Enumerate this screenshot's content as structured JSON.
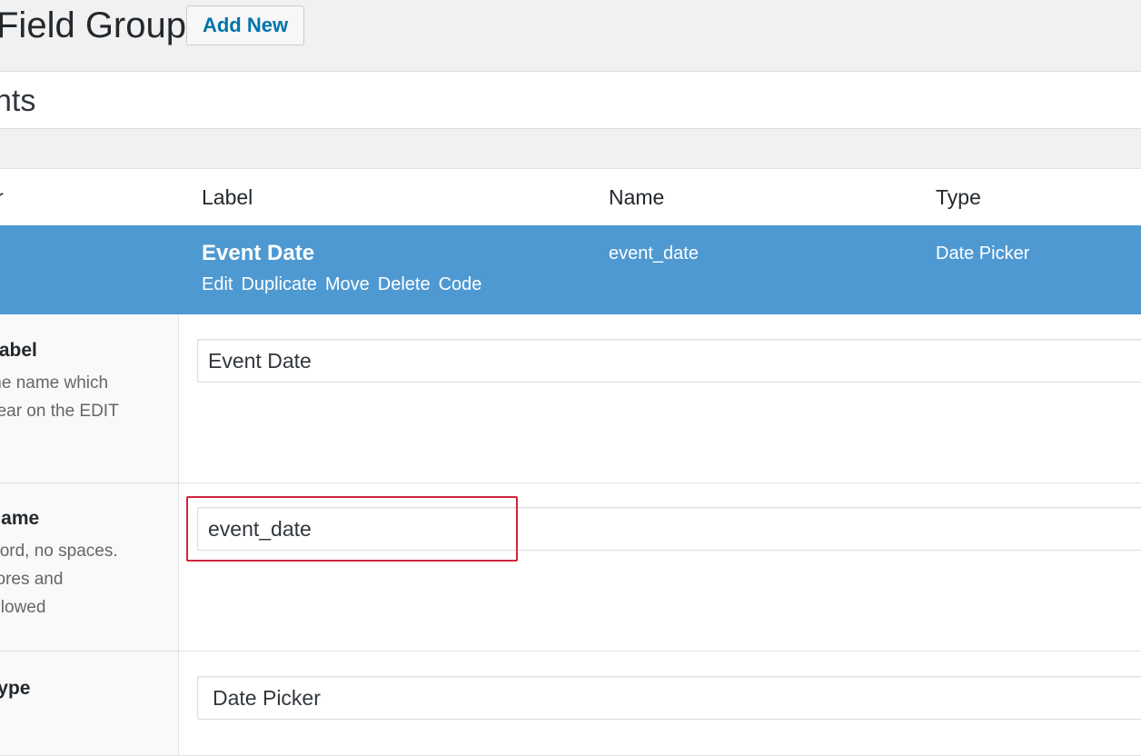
{
  "header": {
    "title": "Field Group",
    "add_new_label": "Add New"
  },
  "title_input": {
    "value": "nts"
  },
  "columns": {
    "order": "r",
    "label": "Label",
    "name": "Name",
    "type": "Type"
  },
  "field": {
    "label": "Event Date",
    "name": "event_date",
    "type": "Date Picker",
    "actions": [
      "Edit",
      "Duplicate",
      "Move",
      "Delete",
      "Code"
    ]
  },
  "settings": {
    "label": {
      "title": "Label",
      "description": [
        "the name which",
        "pear on the EDIT"
      ],
      "value": "Event Date"
    },
    "name": {
      "title": "Name",
      "description": [
        "word, no spaces.",
        "cores and",
        "allowed"
      ],
      "value": "event_date"
    },
    "type": {
      "title": "Type",
      "value": "Date Picker"
    }
  },
  "colors": {
    "accent_row": "#4f99d2",
    "highlight": "#d0253a",
    "link": "#0073aa"
  }
}
